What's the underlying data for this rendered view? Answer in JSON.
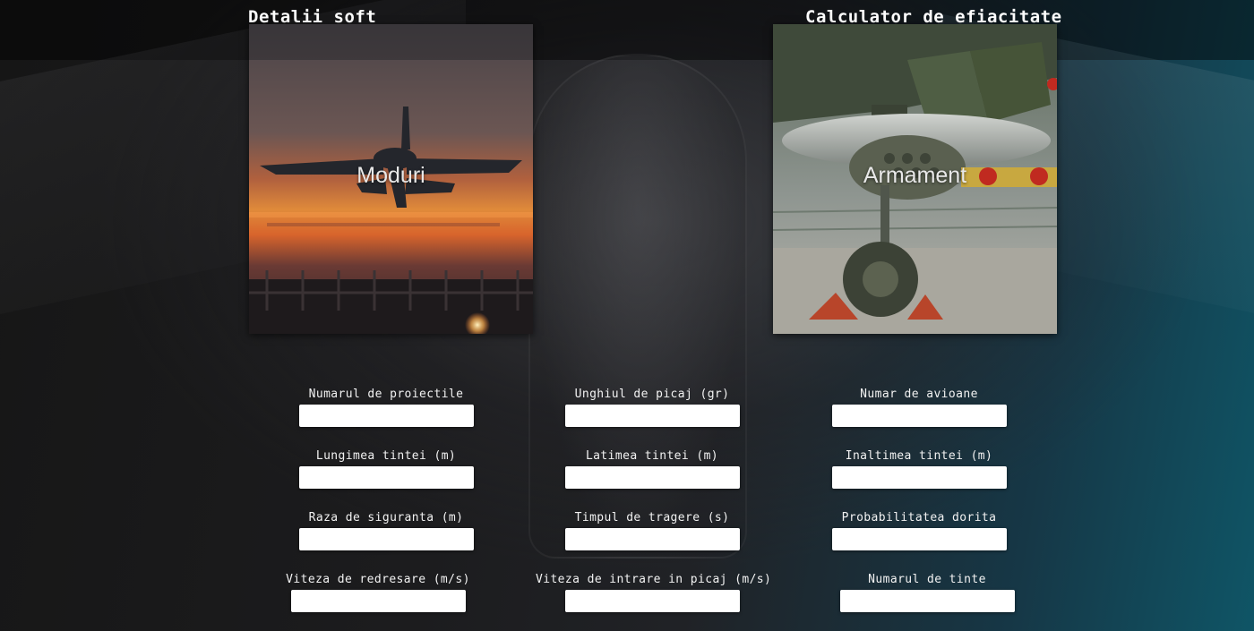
{
  "sections": {
    "left_title": "Detalii soft",
    "right_title": "Calculator de efiacitate"
  },
  "cards": {
    "moduri": {
      "label": "Moduri"
    },
    "armament": {
      "label": "Armament"
    }
  },
  "form": {
    "fields": [
      {
        "label": "Numarul de proiectile",
        "value": ""
      },
      {
        "label": "Unghiul de picaj (gr)",
        "value": ""
      },
      {
        "label": "Numar de avioane",
        "value": ""
      },
      {
        "label": "Lungimea tintei (m)",
        "value": ""
      },
      {
        "label": "Latimea tintei (m)",
        "value": ""
      },
      {
        "label": "Inaltimea tintei (m)",
        "value": ""
      },
      {
        "label": "Raza de siguranta (m)",
        "value": ""
      },
      {
        "label": "Timpul de tragere (s)",
        "value": ""
      },
      {
        "label": "Probabilitatea dorita",
        "value": ""
      },
      {
        "label": "Viteza de redresare (m/s)",
        "value": ""
      },
      {
        "label": "Viteza de intrare in picaj (m/s)",
        "value": ""
      },
      {
        "label": "Numarul de tinte",
        "value": ""
      }
    ]
  }
}
